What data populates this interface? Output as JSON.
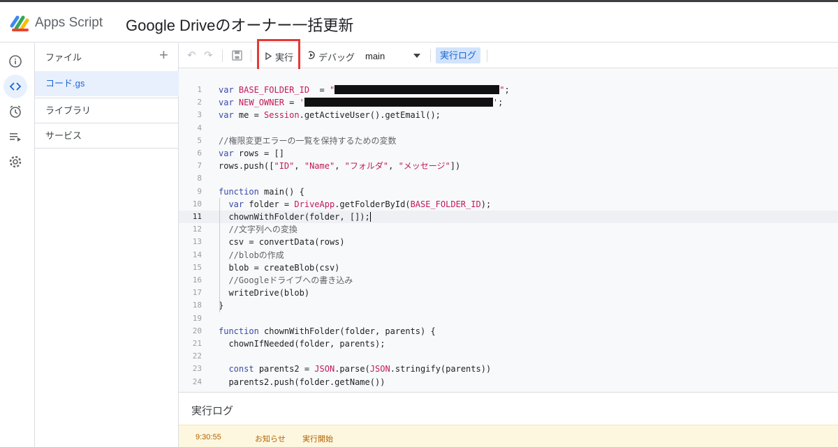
{
  "header": {
    "app_name": "Apps Script",
    "project_title": "Google Driveのオーナー一括更新"
  },
  "rail": {
    "items": [
      {
        "icon": "info-icon"
      },
      {
        "icon": "code-icon",
        "active": true
      },
      {
        "icon": "clock-icon"
      },
      {
        "icon": "executions-icon"
      },
      {
        "icon": "gear-icon"
      }
    ]
  },
  "files_panel": {
    "title": "ファイル",
    "add_label": "+",
    "files": [
      {
        "name": "コード.gs",
        "selected": true
      }
    ],
    "sections": [
      "ライブラリ",
      "サービス"
    ]
  },
  "toolbar": {
    "run_label": "実行",
    "debug_label": "デバッグ",
    "function_selected": "main",
    "exec_log_label": "実行ログ"
  },
  "editor": {
    "current_line": 11,
    "lines": [
      {
        "n": "1",
        "parts": [
          [
            "kw",
            "var "
          ],
          [
            "glob",
            "BASE_FOLDER_ID"
          ],
          [
            "",
            "  = "
          ],
          [
            "str",
            "\""
          ],
          [
            "redact",
            "236"
          ],
          [
            "str",
            "\""
          ],
          [
            "",
            ";"
          ]
        ]
      },
      {
        "n": "2",
        "parts": [
          [
            "kw",
            "var "
          ],
          [
            "glob",
            "NEW_OWNER"
          ],
          [
            "",
            " = "
          ],
          [
            "str",
            "'"
          ],
          [
            "redact",
            "270"
          ],
          [
            "str",
            "'"
          ],
          [
            "",
            ";"
          ]
        ]
      },
      {
        "n": "3",
        "parts": [
          [
            "kw",
            "var "
          ],
          [
            "",
            "me = "
          ],
          [
            "glob",
            "Session"
          ],
          [
            "",
            ".getActiveUser().getEmail();"
          ]
        ]
      },
      {
        "n": "4",
        "parts": []
      },
      {
        "n": "5",
        "parts": [
          [
            "cmt",
            "//権限変更エラーの一覧を保持するための変数"
          ]
        ]
      },
      {
        "n": "6",
        "parts": [
          [
            "kw",
            "var "
          ],
          [
            "",
            "rows = []"
          ]
        ]
      },
      {
        "n": "7",
        "parts": [
          [
            "",
            "rows.push(["
          ],
          [
            "str",
            "\"ID\""
          ],
          [
            "",
            ", "
          ],
          [
            "str",
            "\"Name\""
          ],
          [
            "",
            ", "
          ],
          [
            "str",
            "\"フォルダ\""
          ],
          [
            "",
            ", "
          ],
          [
            "str",
            "\"メッセージ\""
          ],
          [
            "",
            "])"
          ]
        ]
      },
      {
        "n": "8",
        "parts": []
      },
      {
        "n": "9",
        "parts": [
          [
            "kw",
            "function "
          ],
          [
            "",
            "main() {"
          ]
        ]
      },
      {
        "n": "10",
        "parts": [
          [
            "",
            "  "
          ],
          [
            "kw",
            "var "
          ],
          [
            "",
            "folder = "
          ],
          [
            "glob",
            "DriveApp"
          ],
          [
            "",
            ".getFolderById("
          ],
          [
            "glob",
            "BASE_FOLDER_ID"
          ],
          [
            "",
            ");"
          ]
        ]
      },
      {
        "n": "11",
        "parts": [
          [
            "",
            "  chownWithFolder(folder, []);"
          ],
          [
            "cursor",
            ""
          ]
        ]
      },
      {
        "n": "12",
        "parts": [
          [
            "",
            "  "
          ],
          [
            "cmt",
            "//文字列への変換"
          ]
        ]
      },
      {
        "n": "13",
        "parts": [
          [
            "",
            "  csv = convertData(rows)"
          ]
        ]
      },
      {
        "n": "14",
        "parts": [
          [
            "",
            "  "
          ],
          [
            "cmt",
            "//blobの作成"
          ]
        ]
      },
      {
        "n": "15",
        "parts": [
          [
            "",
            "  blob = createBlob(csv)"
          ]
        ]
      },
      {
        "n": "16",
        "parts": [
          [
            "",
            "  "
          ],
          [
            "cmt",
            "//Googleドライブへの書き込み"
          ]
        ]
      },
      {
        "n": "17",
        "parts": [
          [
            "",
            "  writeDrive(blob)"
          ]
        ]
      },
      {
        "n": "18",
        "parts": [
          [
            "",
            "}"
          ]
        ]
      },
      {
        "n": "19",
        "parts": []
      },
      {
        "n": "20",
        "parts": [
          [
            "kw",
            "function "
          ],
          [
            "",
            "chownWithFolder(folder, parents) {"
          ]
        ]
      },
      {
        "n": "21",
        "parts": [
          [
            "",
            "  chownIfNeeded(folder, parents);"
          ]
        ]
      },
      {
        "n": "22",
        "parts": []
      },
      {
        "n": "23",
        "parts": [
          [
            "",
            "  "
          ],
          [
            "kw",
            "const "
          ],
          [
            "",
            "parents2 = "
          ],
          [
            "glob",
            "JSON"
          ],
          [
            "",
            ".parse("
          ],
          [
            "glob",
            "JSON"
          ],
          [
            "",
            ".stringify(parents))"
          ]
        ]
      },
      {
        "n": "24",
        "parts": [
          [
            "",
            "  parents2.push(folder.getName())"
          ]
        ]
      }
    ]
  },
  "log": {
    "title": "実行ログ",
    "entries": [
      {
        "time": "9:30:55",
        "level": "お知らせ",
        "message": "実行開始"
      }
    ]
  },
  "colors": {
    "accent": "#1967d2",
    "highlight_box": "#e53935",
    "log_row_bg": "#fef7e0"
  }
}
